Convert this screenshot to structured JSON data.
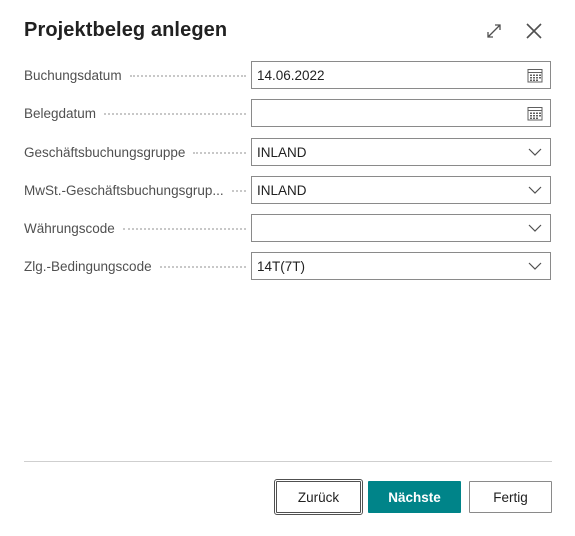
{
  "dialog": {
    "title": "Projektbeleg anlegen",
    "icons": {
      "expand": "expand-icon",
      "close": "close-icon"
    }
  },
  "fields": [
    {
      "label": "Buchungsdatum",
      "value": "14.06.2022",
      "control": "date",
      "icon": "calendar-icon"
    },
    {
      "label": "Belegdatum",
      "value": "",
      "control": "date",
      "icon": "calendar-icon"
    },
    {
      "label": "Geschäftsbuchungsgruppe",
      "value": "INLAND",
      "control": "dropdown",
      "icon": "chevron-down-icon"
    },
    {
      "label": "MwSt.-Geschäftsbuchungsgrup...",
      "value": "INLAND",
      "control": "dropdown",
      "icon": "chevron-down-icon"
    },
    {
      "label": "Währungscode",
      "value": "",
      "control": "dropdown",
      "icon": "chevron-down-icon"
    },
    {
      "label": "Zlg.-Bedingungscode",
      "value": "14T(7T)",
      "control": "dropdown",
      "icon": "chevron-down-icon"
    }
  ],
  "footer": {
    "back_label": "Zurück",
    "next_label": "Nächste",
    "finish_label": "Fertig"
  },
  "colors": {
    "primary": "#008489",
    "border": "#8a8a8a",
    "label": "#505050",
    "text": "#212121"
  }
}
